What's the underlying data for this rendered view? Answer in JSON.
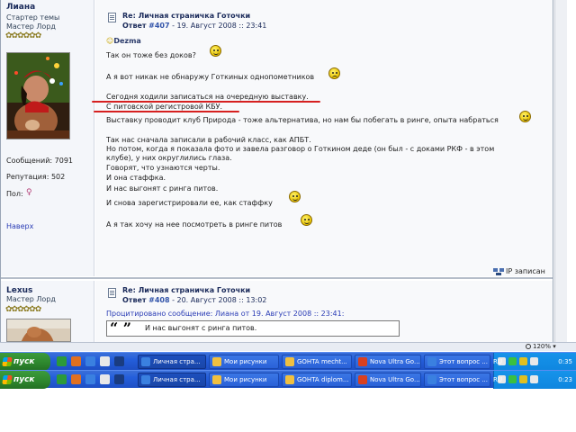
{
  "post1": {
    "author": "Лиана",
    "status1": "Стартер темы",
    "status2": "Мастер Лорд",
    "stars": "✿✿✿✿✿✿",
    "messages": "Сообщений: 7091",
    "reputation": "Репутация: 502",
    "gender": "Пол:",
    "gender_icon": "♀",
    "top_link": "Наверх",
    "title": "Re: Личная страничка Готочки",
    "meta_label": "Ответ",
    "meta_num": "#407",
    "meta_date": "- 19. Август 2008 :: 23:41",
    "mention": "Dezma",
    "lines": [
      "Так он тоже без доков?",
      "А я вот никак не обнаружу Готкиных однопометников",
      "Сегодня ходили записаться на очередную выставку.",
      "С питовской регистровой КБУ.",
      "Выставку проводит клуб Природа - тоже альтернатива, но нам бы побегать в ринге, опыта набраться",
      "Так нас сначала записали в рабочий класс, как АПБТ.",
      "Но потом, когда я показала фото и завела разговор о Готкином деде (он был - с доками РКФ - в этом",
      "клубе), у них округлились глаза.",
      "Говорят, что узнаются черты.",
      "И она стаффка.",
      "И нас выгонят с ринга питов.",
      "И снова зарегистрировали ее, как стаффку",
      "А я так хочу на нее посмотреть в ринге питов"
    ],
    "ip_label": "IP записан"
  },
  "post2": {
    "author": "Lexus",
    "status": "Мастер Лорд",
    "stars": "✿✿✿✿✿✿",
    "title": "Re: Личная страничка Готочки",
    "meta_label": "Ответ",
    "meta_num": "#408",
    "meta_date": "- 20. Август 2008 :: 13:02",
    "quote_title": "Процитировано сообщение: Лиана от 19. Август 2008 :: 23:41:",
    "quote_mark": "“ ”",
    "quote_text": "И нас выгонят с ринга питов."
  },
  "zoom": "120%",
  "taskbar_top": {
    "start": "пуск",
    "buttons": [
      "Личная стра...",
      "Мои рисунки",
      "GOHTA mecht...",
      "Nova Ultra Go...",
      "Этот вопрос ..."
    ],
    "lang": "RU",
    "clock": "0:35"
  },
  "taskbar_bottom": {
    "start": "пуск",
    "buttons": [
      "Личная стра...",
      "Мои рисунки",
      "GOHTA diplom...",
      "Nova Ultra Go...",
      "Этот вопрос ..."
    ],
    "lang": "RU",
    "clock": "0:23"
  },
  "colors": {
    "taskbar": "#245edb",
    "start": "#2f8a2f",
    "highlight_underline": "#d62020",
    "link": "#2a3cb5"
  }
}
